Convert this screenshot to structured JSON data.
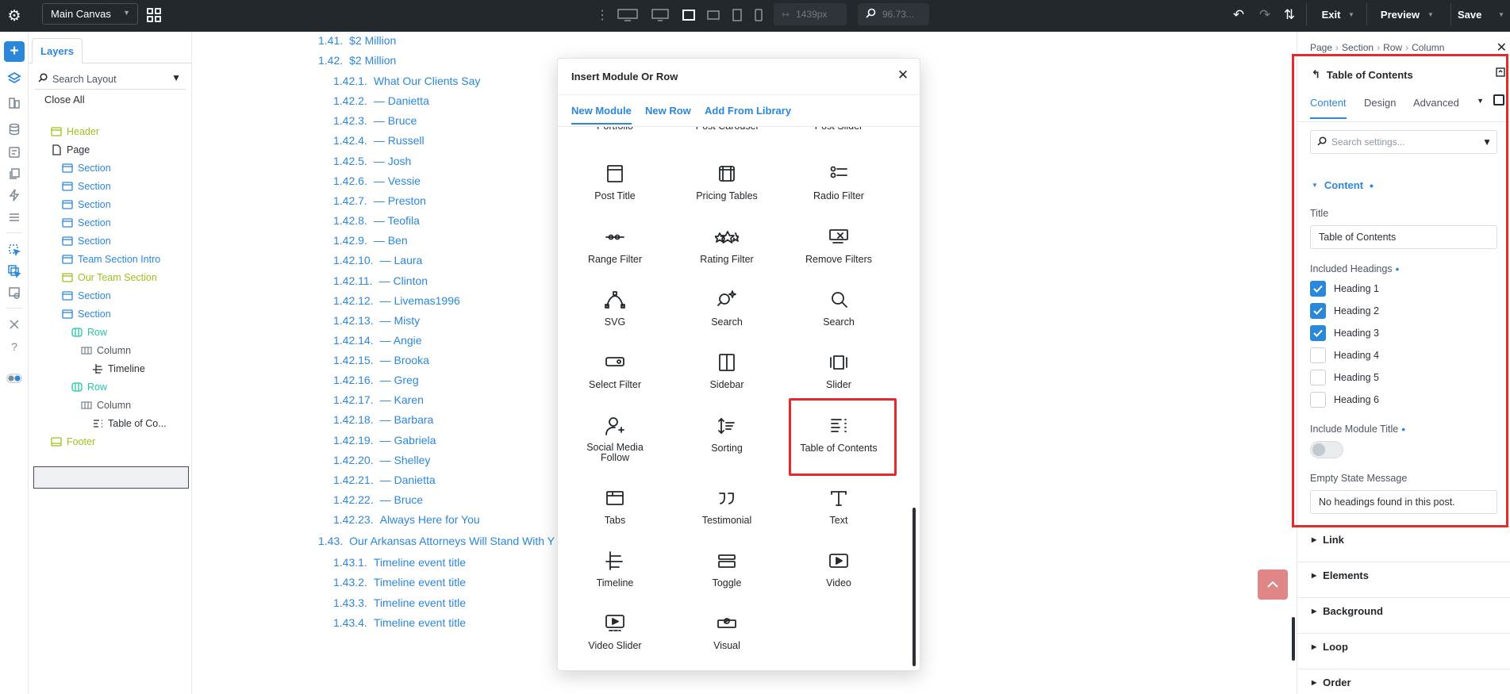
{
  "toolbar": {
    "canvas_select": "Main Canvas",
    "width_value": "1439px",
    "zoom_value": "96.73...",
    "exit_label": "Exit",
    "preview_label": "Preview",
    "save_label": "Save"
  },
  "layers": {
    "tab_label": "Layers",
    "search_placeholder": "Search Layout",
    "close_all": "Close All",
    "tree": [
      {
        "label": "Header",
        "depth": 1,
        "icon": "header-icon",
        "color": "#9bc11d"
      },
      {
        "label": "Page",
        "depth": 1,
        "icon": "page-icon",
        "color": "#2a2f38"
      },
      {
        "label": "Section",
        "depth": 2,
        "icon": "section-icon",
        "color": "#2b87da"
      },
      {
        "label": "Section",
        "depth": 2,
        "icon": "section-icon",
        "color": "#2b87da"
      },
      {
        "label": "Section",
        "depth": 2,
        "icon": "section-icon",
        "color": "#2b87da"
      },
      {
        "label": "Section",
        "depth": 2,
        "icon": "section-icon",
        "color": "#2b87da"
      },
      {
        "label": "Section",
        "depth": 2,
        "icon": "section-icon",
        "color": "#2b87da"
      },
      {
        "label": "Team Section Intro",
        "depth": 2,
        "icon": "section-icon",
        "color": "#2b87da"
      },
      {
        "label": "Our Team Section",
        "depth": 2,
        "icon": "section-icon",
        "color": "#9bc11d"
      },
      {
        "label": "Section",
        "depth": 2,
        "icon": "section-icon",
        "color": "#2b87da"
      },
      {
        "label": "Section",
        "depth": 2,
        "icon": "section-icon",
        "color": "#2b87da"
      },
      {
        "label": "Row",
        "depth": 3,
        "icon": "row-icon",
        "color": "#29c4a9"
      },
      {
        "label": "Column",
        "depth": 4,
        "icon": "column-icon",
        "color": "#7c8996"
      },
      {
        "label": "Timeline",
        "depth": 5,
        "icon": "timeline-icon",
        "color": "#2a2f38"
      },
      {
        "label": "Row",
        "depth": 3,
        "icon": "row-icon",
        "color": "#29c4a9"
      },
      {
        "label": "Column",
        "depth": 4,
        "icon": "column-icon",
        "color": "#7c8996"
      },
      {
        "label": "Table of Co...",
        "depth": 5,
        "icon": "toc-icon",
        "color": "#2a2f38"
      },
      {
        "label": "Footer",
        "depth": 1,
        "icon": "footer-icon",
        "color": "#9bc11d"
      }
    ]
  },
  "toc": [
    {
      "num": "1.41.",
      "text": "$2 Million",
      "level": 1
    },
    {
      "num": "1.42.",
      "text": "$2 Million",
      "level": 1
    },
    {
      "num": "1.42.1.",
      "text": "What Our Clients Say",
      "level": 2
    },
    {
      "num": "1.42.2.",
      "text": "— Danietta",
      "level": 2
    },
    {
      "num": "1.42.3.",
      "text": "— Bruce",
      "level": 2
    },
    {
      "num": "1.42.4.",
      "text": "— Russell",
      "level": 2
    },
    {
      "num": "1.42.5.",
      "text": "— Josh",
      "level": 2
    },
    {
      "num": "1.42.6.",
      "text": "— Vessie",
      "level": 2
    },
    {
      "num": "1.42.7.",
      "text": "— Preston",
      "level": 2
    },
    {
      "num": "1.42.8.",
      "text": "— Teofila",
      "level": 2
    },
    {
      "num": "1.42.9.",
      "text": "— Ben",
      "level": 2
    },
    {
      "num": "1.42.10.",
      "text": "— Laura",
      "level": 2
    },
    {
      "num": "1.42.11.",
      "text": "— Clinton",
      "level": 2
    },
    {
      "num": "1.42.12.",
      "text": "— Livemas1996",
      "level": 2
    },
    {
      "num": "1.42.13.",
      "text": "— Misty",
      "level": 2
    },
    {
      "num": "1.42.14.",
      "text": "— Angie",
      "level": 2
    },
    {
      "num": "1.42.15.",
      "text": "— Brooka",
      "level": 2
    },
    {
      "num": "1.42.16.",
      "text": "— Greg",
      "level": 2
    },
    {
      "num": "1.42.17.",
      "text": "— Karen",
      "level": 2
    },
    {
      "num": "1.42.18.",
      "text": "— Barbara",
      "level": 2
    },
    {
      "num": "1.42.19.",
      "text": "— Gabriela",
      "level": 2
    },
    {
      "num": "1.42.20.",
      "text": "— Shelley",
      "level": 2
    },
    {
      "num": "1.42.21.",
      "text": "— Danietta",
      "level": 2
    },
    {
      "num": "1.42.22.",
      "text": "— Bruce",
      "level": 2
    },
    {
      "num": "1.42.23.",
      "text": "Always Here for You",
      "level": 2
    },
    {
      "num": "1.43.",
      "text": "Our Arkansas Attorneys Will Stand With Y",
      "level": 1
    },
    {
      "num": "1.43.1.",
      "text": "Timeline event title",
      "level": 2
    },
    {
      "num": "1.43.2.",
      "text": "Timeline event title",
      "level": 2
    },
    {
      "num": "1.43.3.",
      "text": "Timeline event title",
      "level": 2
    },
    {
      "num": "1.43.4.",
      "text": "Timeline event title",
      "level": 2
    }
  ],
  "dialog": {
    "title": "Insert Module Or Row",
    "tabs": [
      "New Module",
      "New Row",
      "Add From Library"
    ],
    "modules": [
      {
        "label": "Portfolio",
        "icon": ""
      },
      {
        "label": "Post Carousel",
        "icon": ""
      },
      {
        "label": "Post Slider",
        "icon": ""
      },
      {
        "label": "Post Title",
        "icon": "post-title-icon"
      },
      {
        "label": "Pricing Tables",
        "icon": "pricing-tables-icon"
      },
      {
        "label": "Radio Filter",
        "icon": "radio-filter-icon"
      },
      {
        "label": "Range Filter",
        "icon": "range-filter-icon"
      },
      {
        "label": "Rating Filter",
        "icon": "rating-filter-icon"
      },
      {
        "label": "Remove Filters",
        "icon": "remove-filters-icon"
      },
      {
        "label": "SVG",
        "icon": "svg-icon"
      },
      {
        "label": "Search",
        "icon": "search-sparkle-icon"
      },
      {
        "label": "Search",
        "icon": "search-icon"
      },
      {
        "label": "Select Filter",
        "icon": "select-filter-icon"
      },
      {
        "label": "Sidebar",
        "icon": "sidebar-icon"
      },
      {
        "label": "Slider",
        "icon": "slider-icon"
      },
      {
        "label": "Social Media Follow",
        "icon": "social-media-follow-icon"
      },
      {
        "label": "Sorting",
        "icon": "sorting-icon"
      },
      {
        "label": "Table of Contents",
        "icon": "table-of-contents-icon"
      },
      {
        "label": "Tabs",
        "icon": "tabs-icon"
      },
      {
        "label": "Testimonial",
        "icon": "testimonial-icon"
      },
      {
        "label": "Text",
        "icon": "text-icon"
      },
      {
        "label": "Timeline",
        "icon": "timeline-icon"
      },
      {
        "label": "Toggle",
        "icon": "toggle-icon"
      },
      {
        "label": "Video",
        "icon": "video-icon"
      },
      {
        "label": "Video Slider",
        "icon": "video-slider-icon"
      },
      {
        "label": "Visual",
        "icon": "visual-icon"
      }
    ]
  },
  "panel": {
    "breadcrumb": [
      "Page",
      "Section",
      "Row",
      "Column"
    ],
    "module_title": "Table of Contents",
    "tabs": [
      "Content",
      "Design",
      "Advanced"
    ],
    "search_placeholder": "Search settings...",
    "content_section": "Content",
    "title_label": "Title",
    "title_value": "Table of Contents",
    "headings_label": "Included Headings",
    "headings": [
      {
        "label": "Heading 1",
        "checked": true
      },
      {
        "label": "Heading 2",
        "checked": true
      },
      {
        "label": "Heading 3",
        "checked": true
      },
      {
        "label": "Heading 4",
        "checked": false
      },
      {
        "label": "Heading 5",
        "checked": false
      },
      {
        "label": "Heading 6",
        "checked": false
      }
    ],
    "include_title_label": "Include Module Title",
    "include_title_on": false,
    "empty_label": "Empty State Message",
    "empty_value": "No headings found in this post.",
    "sections": [
      "Link",
      "Elements",
      "Background",
      "Loop",
      "Order"
    ]
  },
  "colors": {
    "accent": "#2b87da",
    "highlight": "#e32b2b",
    "topbar": "#23282d",
    "layer_green": "#9bc11d",
    "layer_teal": "#29c4a9"
  }
}
